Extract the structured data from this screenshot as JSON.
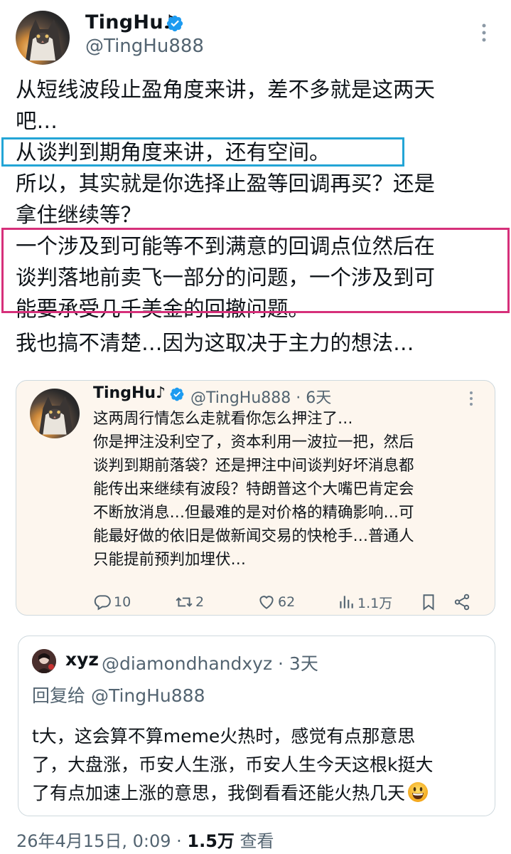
{
  "author": {
    "display_name": "TingHu♪",
    "handle": "@TingHu888",
    "verified": true,
    "avatar": "cat-portrait-avatar"
  },
  "tweet": {
    "lines": [
      "从短线波段止盈角度来讲，差不多就是这两天",
      "吧…",
      "从谈判到期角度来讲，还有空间。",
      "所以，其实就是你选择止盈等回调再买？还是",
      "拿住继续等？",
      "一个涉及到可能等不到满意的回调点位然后在",
      "谈判落地前卖飞一部分的问题，一个涉及到可",
      "能要承受几千美金的回撤问题。",
      "我也搞不清楚…因为这取决于主力的想法…"
    ]
  },
  "quoted": {
    "display_name": "TingHu♪",
    "handle_time": "@TingHu888 · 6天",
    "lines": [
      "这两周行情怎么走就看你怎么押注了…",
      "你是押注没利空了，资本利用一波拉一把，然后",
      "谈判到期前落袋？还是押注中间谈判好坏消息都",
      "能传出来继续有波段？特朗普这个大嘴巴肯定会",
      "不断放消息…但最难的是对价格的精确影响…可",
      "能最好做的依旧是做新闻交易的快枪手…普通人",
      "只能提前预判加埋伏…"
    ],
    "actions": {
      "replies": "10",
      "retweets": "2",
      "likes": "62",
      "views": "1.1万"
    }
  },
  "reply": {
    "display_name": "xyz",
    "handle_time": "@diamondhandxyz · 3天",
    "reply_to_prefix": "回复给",
    "reply_to_handle": "@TingHu888",
    "lines": [
      "t大，这会算不算meme火热时，感觉有点那意思",
      "了，大盘涨，币安人生涨，币安人生今天这根k挺大",
      "了有点加速上涨的意思，我倒看看还能火热几天"
    ],
    "emoji": "grinning-face-emoji"
  },
  "footer": {
    "timestamp": "26年4月15日, 0:09 · ",
    "views_count": "1.5万",
    "views_label": " 查看"
  },
  "colors": {
    "verified": "#1d9bf0",
    "highlight_blue": "#23a5d6",
    "highlight_pink": "#d6307a",
    "quote_bg": "#fdf6ee",
    "muted": "#536471"
  }
}
